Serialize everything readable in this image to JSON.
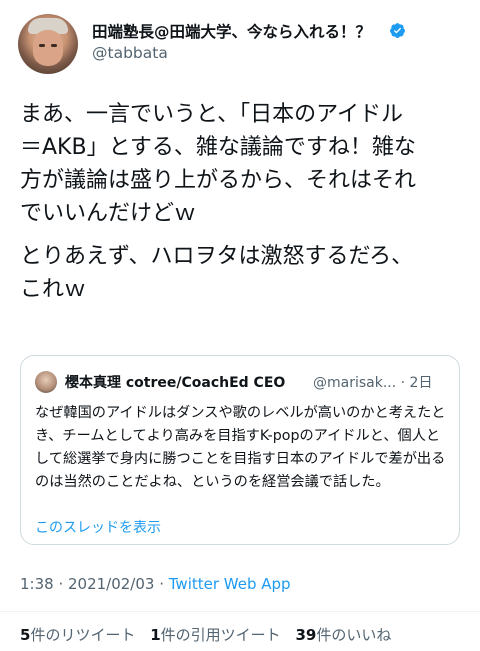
{
  "author": {
    "name": "田端塾長@田端大学、今なら入れる！？",
    "handle": "@tabbata"
  },
  "tweet": {
    "paragraphs": [
      "まあ、一言でいうと、「日本のアイドル\n＝AKB」とする、雑な議論ですね！雑な\n方が議論は盛り上がるから、それはそれ\nでいいんだけどｗ",
      "とりあえず、ハロヲタは激怒するだろ、\nこれｗ"
    ]
  },
  "quoted": {
    "name": "櫻本真理 cotree/CoachEd CEO",
    "handle": "@marisak... · 2日",
    "text": "なぜ韓国のアイドルはダンスや歌のレベルが高いのかと考えたとき、チームとしてより高みを目指すK-popのアイドルと、個人として総選挙で身内に勝つことを目指す日本のアイドルで差が出るのは当然のことだよね、というのを経営会議で話した。",
    "thread_link": "このスレッドを表示"
  },
  "meta": {
    "time": "1:38 · 2021/02/03 · ",
    "app": "Twitter Web App"
  },
  "stats": {
    "retweets": "5",
    "retweets_label": "件のリツイート",
    "quotes": "1",
    "quotes_label": "件の引用ツイート",
    "likes": "39",
    "likes_label": "件のいいね"
  },
  "colors": {
    "accent": "#1d9bf0",
    "muted": "#536471",
    "border": "#cfd9de"
  }
}
